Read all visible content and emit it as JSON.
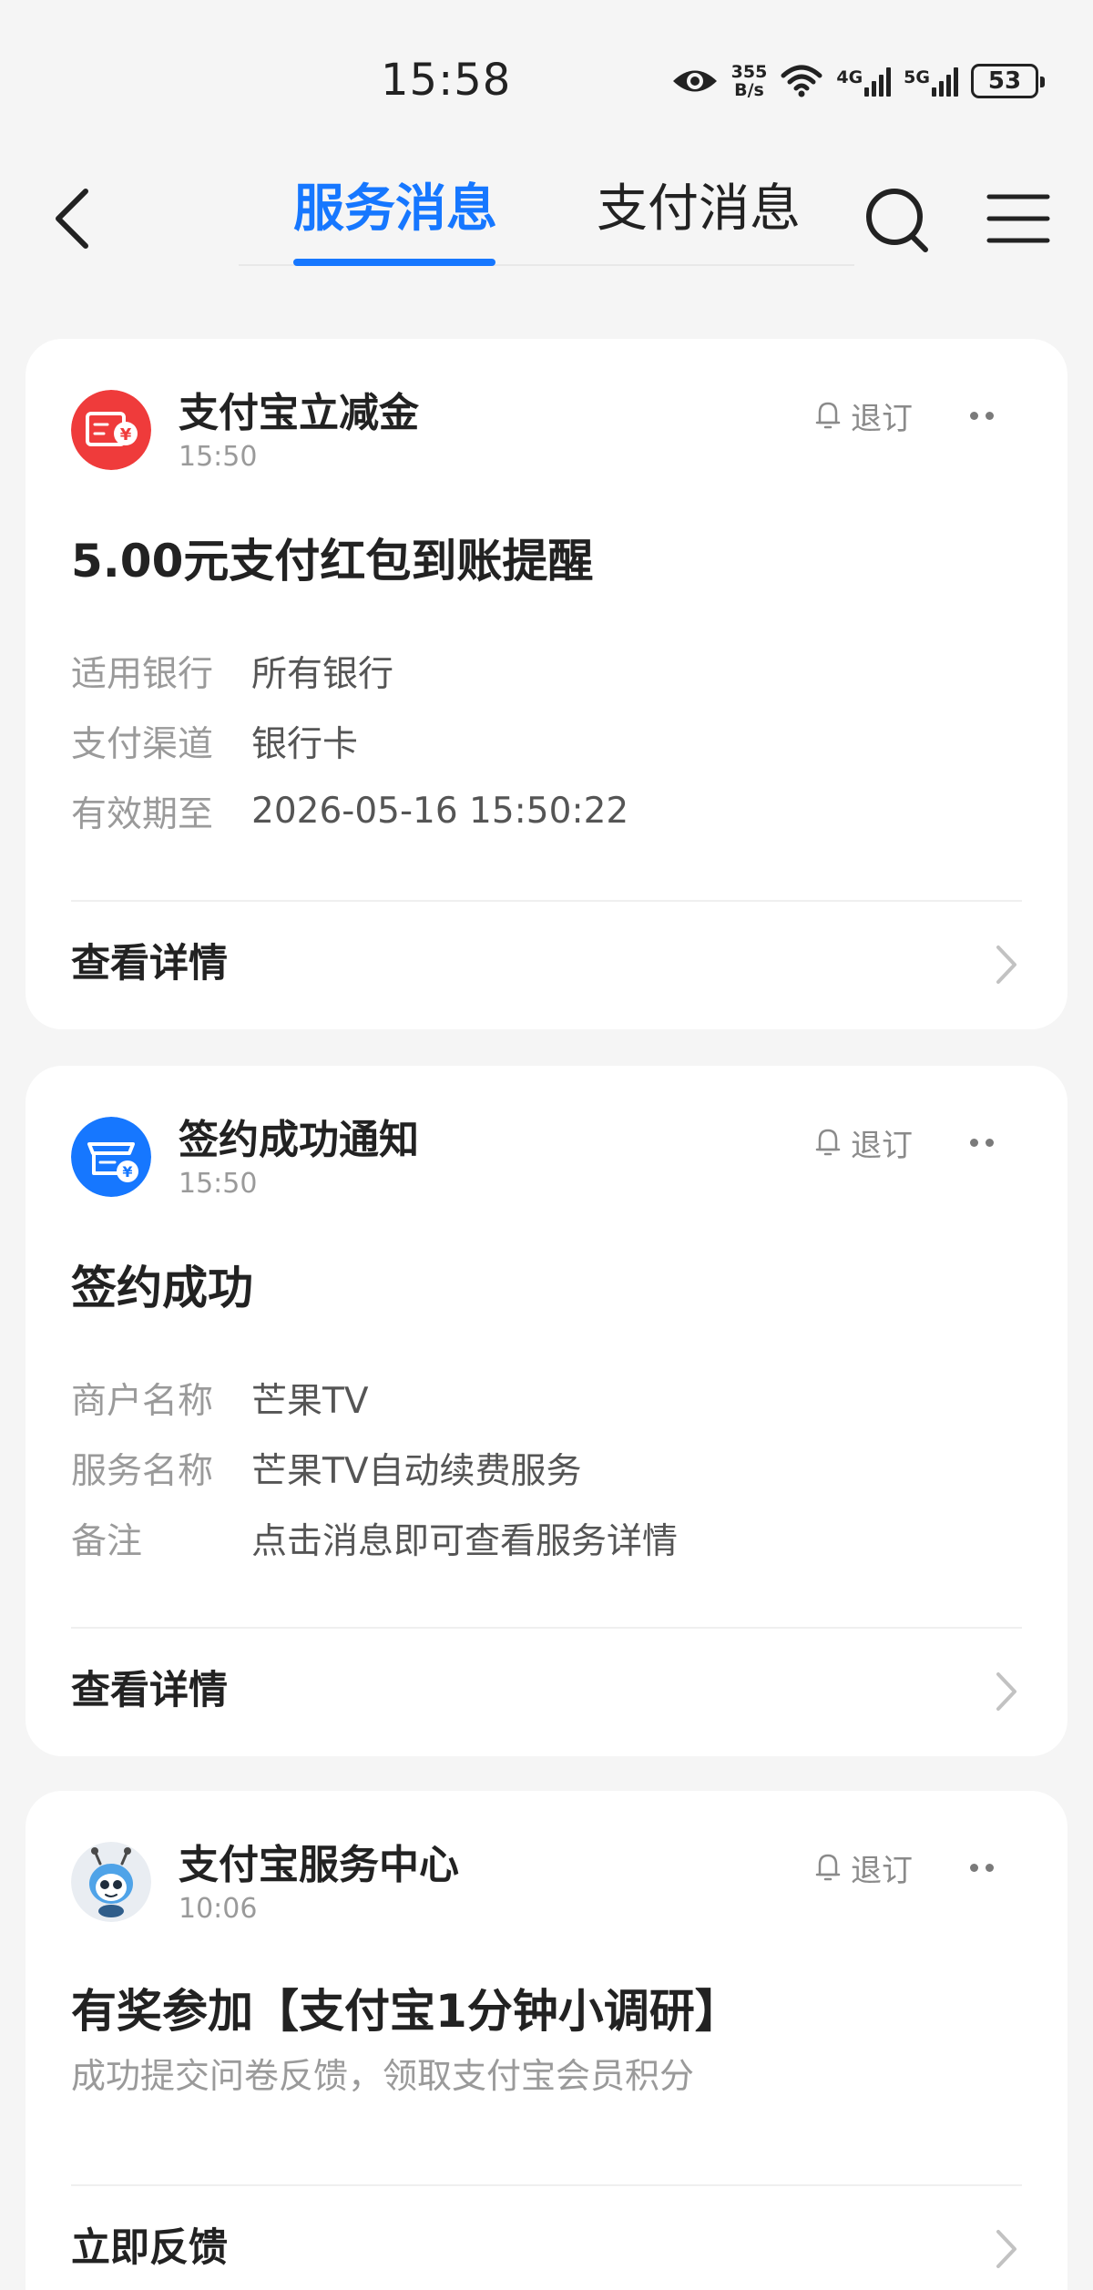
{
  "status_bar": {
    "time": "15:58",
    "speed_value": "355",
    "speed_unit": "B/s",
    "net1": "4G",
    "net2": "5G",
    "battery": "53"
  },
  "header": {
    "tabs": [
      {
        "label": "服务消息",
        "active": true
      },
      {
        "label": "支付消息",
        "active": false
      }
    ],
    "accent_color": "#1677ff"
  },
  "cards": [
    {
      "sender": "支付宝立减金",
      "time": "15:50",
      "unsubscribe_label": "退订",
      "title": "5.00元支付红包到账提醒",
      "fields": [
        {
          "label": "适用银行",
          "value": "所有银行"
        },
        {
          "label": "支付渠道",
          "value": "银行卡"
        },
        {
          "label": "有效期至",
          "value": "2026-05-16 15:50:22"
        }
      ],
      "action": "查看详情",
      "icon": "red-packet-voucher-icon",
      "icon_color": "#ef3b3b"
    },
    {
      "sender": "签约成功通知",
      "time": "15:50",
      "unsubscribe_label": "退订",
      "title": "签约成功",
      "fields": [
        {
          "label": "商户名称",
          "value": "芒果TV"
        },
        {
          "label": "服务名称",
          "value": "芒果TV自动续费服务"
        },
        {
          "label": "备注",
          "value": "点击消息即可查看服务详情"
        }
      ],
      "action": "查看详情",
      "icon": "shop-contract-icon",
      "icon_color": "#1677ff"
    },
    {
      "sender": "支付宝服务中心",
      "time": "10:06",
      "unsubscribe_label": "退订",
      "title": "有奖参加【支付宝1分钟小调研】",
      "subtitle": "成功提交问卷反馈，领取支付宝会员积分",
      "action": "立即反馈",
      "icon": "ant-mascot-icon"
    }
  ]
}
